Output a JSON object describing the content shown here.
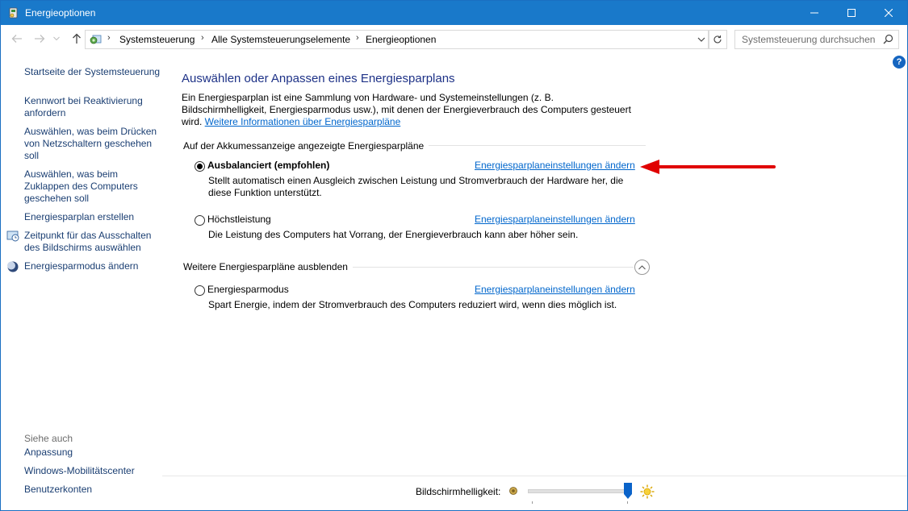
{
  "window": {
    "title": "Energieoptionen",
    "controls": {
      "minimize": "minimize",
      "maximize": "maximize",
      "close": "close"
    }
  },
  "address": {
    "crumbs": [
      "Systemsteuerung",
      "Alle Systemsteuerungselemente",
      "Energieoptionen"
    ],
    "search_placeholder": "Systemsteuerung durchsuchen"
  },
  "help": {
    "label": "?"
  },
  "sidebar": {
    "home": "Startseite der Systemsteuerung",
    "links": [
      "Kennwort bei Reaktivierung anfordern",
      "Auswählen, was beim Drücken von Netzschaltern geschehen soll",
      "Auswählen, was beim Zuklappen des Computers geschehen soll",
      "Energiesparplan erstellen",
      "Zeitpunkt für das Ausschalten des Bildschirms auswählen",
      "Energiesparmodus ändern"
    ],
    "see_also_title": "Siehe auch",
    "see_also": [
      "Anpassung",
      "Windows-Mobilitätscenter",
      "Benutzerkonten"
    ]
  },
  "main": {
    "heading": "Auswählen oder Anpassen eines Energiesparplans",
    "intro_text": "Ein Energiesparplan ist eine Sammlung von Hardware- und Systemeinstellungen (z. B. Bildschirmhelligkeit, Energiesparmodus usw.), mit denen der Energieverbrauch des Computers gesteuert wird. ",
    "intro_link": "Weitere Informationen über Energiesparpläne",
    "group1_label": "Auf der Akkumessanzeige angezeigte Energiesparpläne",
    "group2_label": "Weitere Energiesparpläne ausblenden",
    "change_link": "Energiesparplaneinstellungen ändern",
    "plans": [
      {
        "name": "Ausbalanciert (empfohlen)",
        "selected": true,
        "desc": "Stellt automatisch einen Ausgleich zwischen Leistung und Stromverbrauch der Hardware her, die diese Funktion unterstützt."
      },
      {
        "name": "Höchstleistung",
        "selected": false,
        "desc": "Die Leistung des Computers hat Vorrang, der Energieverbrauch kann aber höher sein."
      },
      {
        "name": "Energiesparmodus",
        "selected": false,
        "desc": "Spart Energie, indem der Stromverbrauch des Computers reduziert wird, wenn dies möglich ist."
      }
    ]
  },
  "statusbar": {
    "brightness_label": "Bildschirmhelligkeit:",
    "brightness_level": 1.0
  },
  "colors": {
    "titlebar": "#1979ca",
    "link": "#0066cc",
    "heading": "#1e3287",
    "arrow": "#e00000"
  }
}
